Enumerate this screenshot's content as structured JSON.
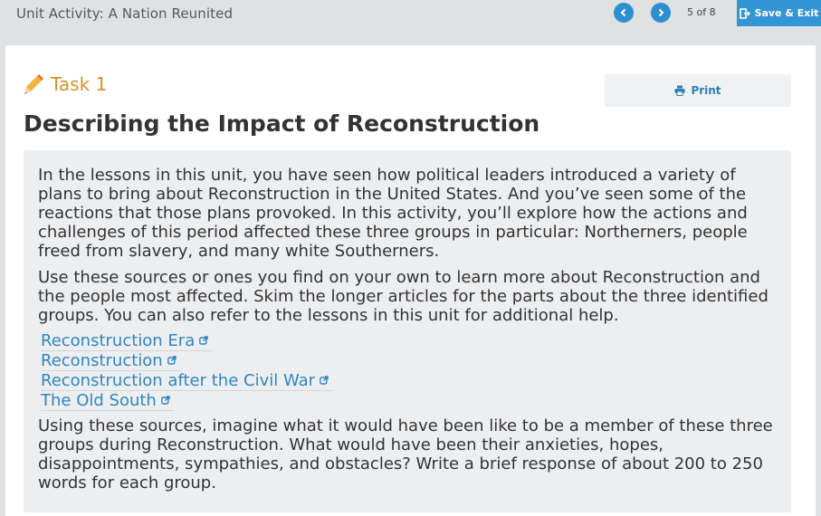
{
  "app": {
    "title": "Unit Activity: A Nation Reunited"
  },
  "nav": {
    "page_text": "5 of 8",
    "save_exit_label": "Save & Exit"
  },
  "task": {
    "label": "Task 1",
    "print_label": "Print"
  },
  "page": {
    "title": "Describing the Impact of Reconstruction"
  },
  "content": {
    "paragraphs": [
      "In the lessons in this unit, you have seen how political leaders introduced a variety of plans to bring about Reconstruction in the United States. And you’ve seen some of the reactions that those plans provoked. In this activity, you’ll explore how the actions and challenges of this period affected these three groups in particular: Northerners, people freed from slavery, and many white Southerners.",
      "Use these sources or ones you find on your own to learn more about Reconstruction and the people most affected. Skim the longer articles for the parts about the three identified groups. You can also refer to the lessons in this unit for additional help.",
      "Using these sources, imagine what it would have been like to be a member of these three groups during Reconstruction. What would have been their anxieties, hopes, disappointments, sympathies, and obstacles? Write a brief response of about 200 to 250 words for each group."
    ],
    "links": [
      {
        "label": "Reconstruction Era"
      },
      {
        "label": "Reconstruction"
      },
      {
        "label": "Reconstruction after the Civil War"
      },
      {
        "label": "The Old South"
      }
    ]
  },
  "icons": {
    "prev": "chevron-left-icon",
    "next": "chevron-right-icon",
    "save": "exit-door-icon",
    "task": "pencil-icon",
    "print": "printer-icon",
    "link": "external-link-icon"
  },
  "colors": {
    "accent": "#2e8fd0",
    "task": "#d9922b",
    "link": "#2f86c0",
    "topbar": "#dfe1e3"
  }
}
